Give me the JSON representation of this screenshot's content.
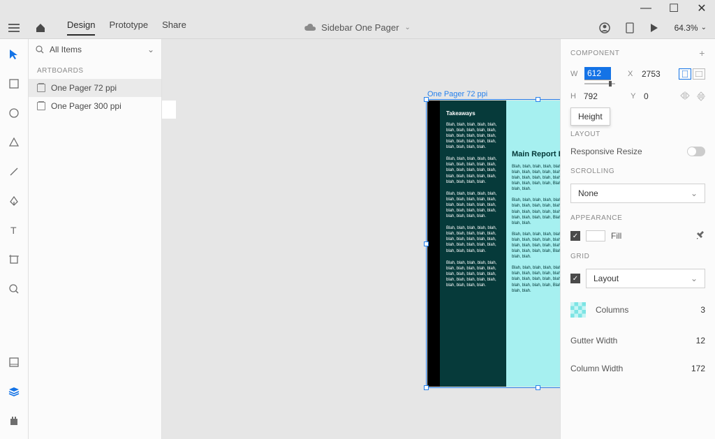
{
  "window": {
    "minimize": "—",
    "maximize": "☐",
    "close": "✕"
  },
  "topbar": {
    "tabs": {
      "design": "Design",
      "prototype": "Prototype",
      "share": "Share"
    },
    "docTitle": "Sidebar One Pager",
    "zoom": "64.3%"
  },
  "leftpanel": {
    "searchLabel": "All Items",
    "sectionArtboards": "ARTBOARDS",
    "artboards": [
      {
        "label": "One Pager 72 ppi"
      },
      {
        "label": "One Pager 300 ppi"
      }
    ]
  },
  "canvas": {
    "artboardLabel": "One Pager 72 ppi",
    "sidebarTitle": "Takeaways",
    "sidebarPara": "Blah, blah, blah, blah, blah, blah, blah, blah, blah, blah, blah, blah, blah, blah, blah, blah, blah, blah, blah, blah, blah, blah, blah, blah.",
    "bodyTitle": "Main Report Body",
    "bodyPara": "Blah, blah, blah, blah, blah, blah, blah, blah, blah, blah, Blah, blah, blah, blah, blah, blah, blah, blah, blah, blah, Blah, blah, blah, blah, blah, blah, blah, blah, blah, blah, Blah, blah, blah, blah, blah, blah, blah, blah, blah, blah, Blah, blah, blah, blah, blah, blah, blah, blah, blah, blah."
  },
  "rightpanel": {
    "component": "COMPONENT",
    "W": "W",
    "Wval": "612",
    "X": "X",
    "Xval": "2753",
    "H": "H",
    "Hval": "792",
    "Y": "Y",
    "Yval": "0",
    "tooltip": "Height",
    "layout": "LAYOUT",
    "responsiveResize": "Responsive Resize",
    "scrolling": "SCROLLING",
    "scrollValue": "None",
    "appearance": "APPEARANCE",
    "fill": "Fill",
    "grid": "GRID",
    "gridLayout": "Layout",
    "columns": "Columns",
    "columnsVal": "3",
    "gutterWidth": "Gutter Width",
    "gutterVal": "12",
    "columnWidth": "Column Width",
    "columnWidthVal": "172"
  }
}
